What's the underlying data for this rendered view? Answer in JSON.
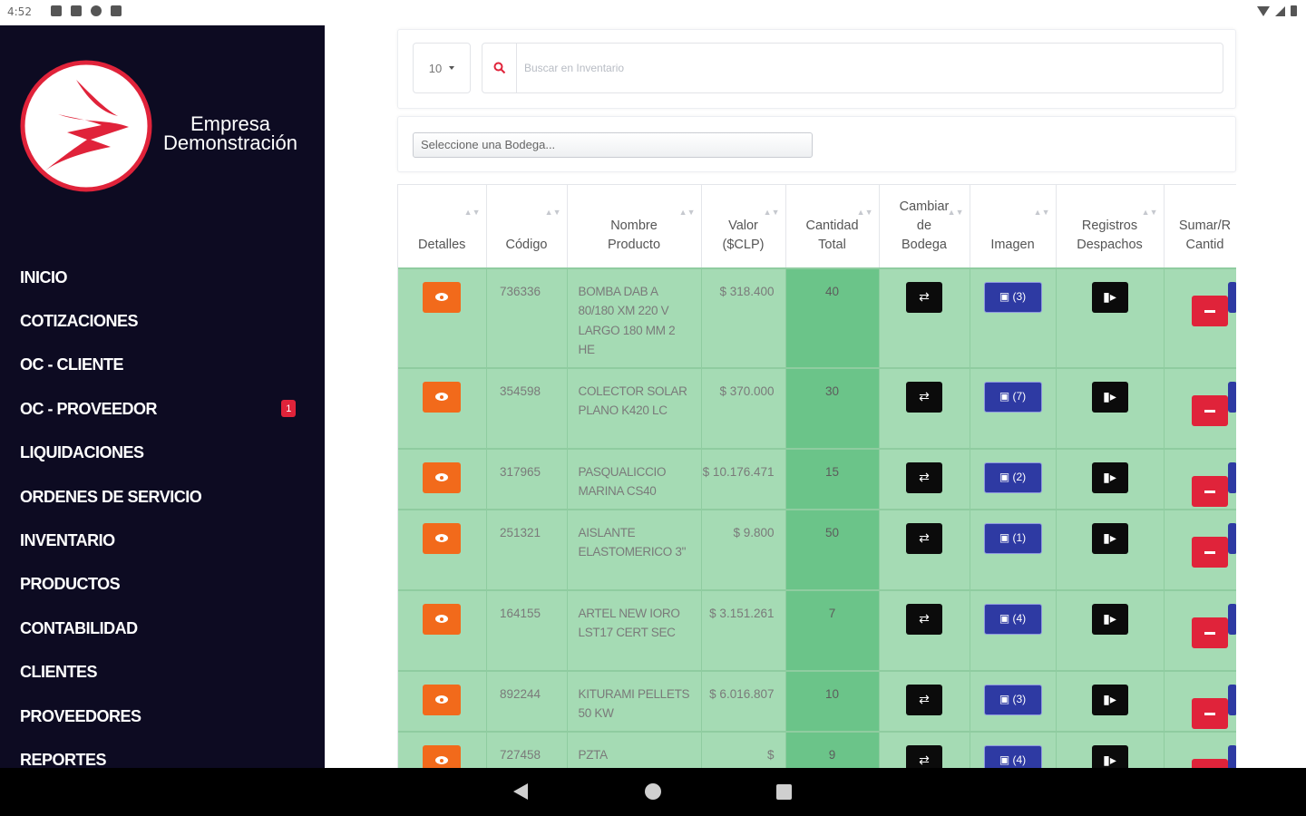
{
  "statusbar": {
    "time": "4:52"
  },
  "sidebar": {
    "company_name": "Empresa Demonstración",
    "brand_color": "#e0233a",
    "menu": [
      {
        "label": "INICIO"
      },
      {
        "label": "COTIZACIONES"
      },
      {
        "label": "OC - CLIENTE"
      },
      {
        "label": "OC - PROVEEDOR",
        "badge": "1"
      },
      {
        "label": "LIQUIDACIONES"
      },
      {
        "label": "ORDENES DE SERVICIO"
      },
      {
        "label": "INVENTARIO"
      },
      {
        "label": "PRODUCTOS"
      },
      {
        "label": "CONTABILIDAD"
      },
      {
        "label": "CLIENTES"
      },
      {
        "label": "PROVEEDORES"
      },
      {
        "label": "REPORTES"
      }
    ]
  },
  "search": {
    "page_size": "10",
    "placeholder": "Buscar en Inventario"
  },
  "bodega": {
    "placeholder": "Seleccione una Bodega..."
  },
  "table": {
    "headers": [
      "Detalles",
      "Código",
      "Nombre Producto",
      "Valor ($CLP)",
      "Cantidad Total",
      "Cambiar de Bodega",
      "Imagen",
      "Registros Despachos",
      "Sumar/R Cantid"
    ],
    "rows": [
      {
        "code": "736336",
        "name": "BOMBA DAB A 80/180 XM 220 V LARGO 180 MM 2 HE",
        "price": "$ 318.400",
        "qty": "40",
        "images": "(3)"
      },
      {
        "code": "354598",
        "name": "COLECTOR SOLAR PLANO K420 LC",
        "price": "$ 370.000",
        "qty": "30",
        "images": "(7)"
      },
      {
        "code": "317965",
        "name": "PASQUALICCIO MARINA CS40",
        "price": "$ 10.176.471",
        "qty": "15",
        "images": "(2)"
      },
      {
        "code": "251321",
        "name": "AISLANTE ELASTOMERICO 3\"",
        "price": "$ 9.800",
        "qty": "50",
        "images": "(1)"
      },
      {
        "code": "164155",
        "name": "ARTEL NEW IORO LST17 CERT SEC",
        "price": "$ 3.151.261",
        "qty": "7",
        "images": "(4)"
      },
      {
        "code": "892244",
        "name": "KITURAMI PELLETS 50 KW",
        "price": "$ 6.016.807",
        "qty": "10",
        "images": "(3)"
      },
      {
        "code": "727458",
        "name": "PZTA",
        "price": "$",
        "qty": "9",
        "images": "(4)"
      }
    ]
  },
  "colors": {
    "sidebar_bg": "#0d0b22",
    "row_bg": "#a5dbb4",
    "qty_bg": "#6bc489",
    "detail_button": "#f26a1b",
    "image_button": "#2e3aa3",
    "minus_button": "#e0233a"
  },
  "icons": {
    "detail": "eye-icon",
    "change_bodega": "swap-icon",
    "image": "image-icon",
    "dispatch": "truck-icon",
    "subtract": "minus-icon",
    "search": "search-icon"
  }
}
